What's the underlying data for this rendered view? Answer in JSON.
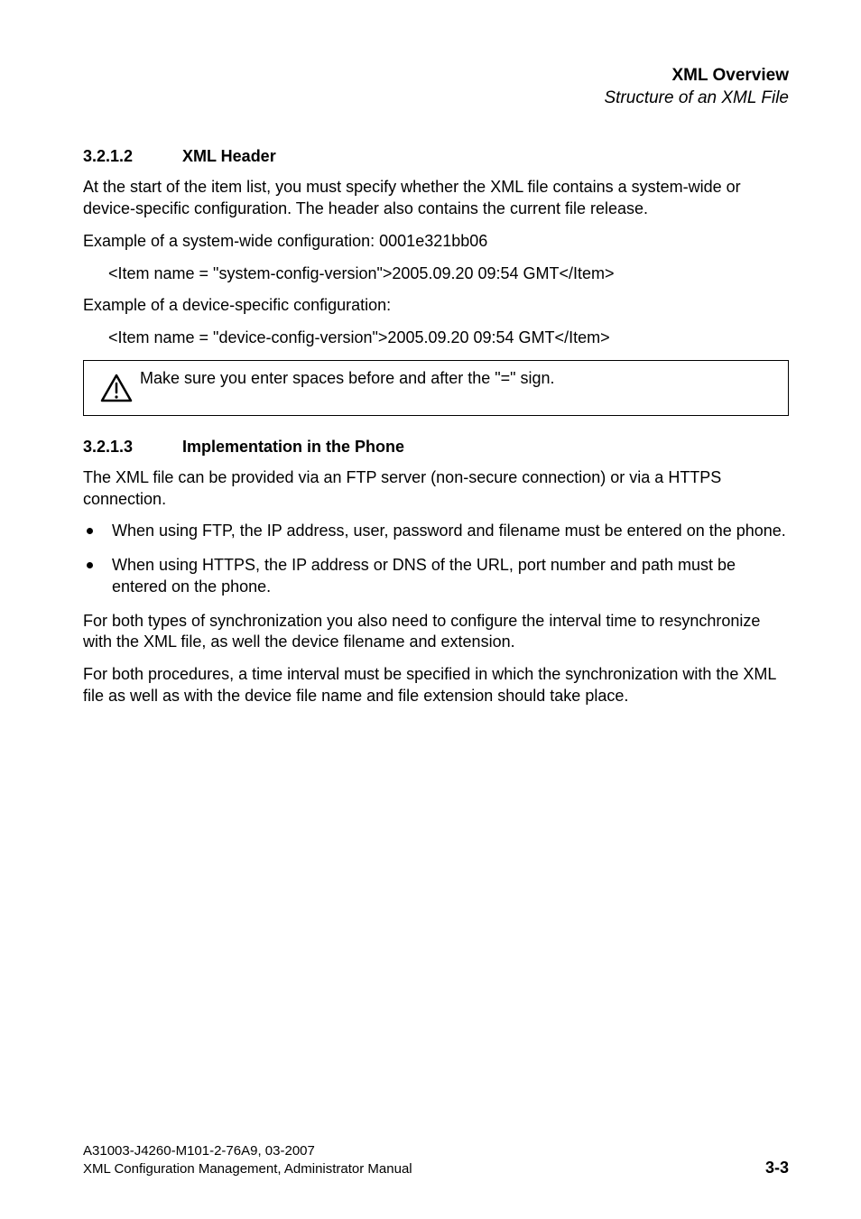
{
  "header": {
    "title": "XML Overview",
    "subtitle": "Structure of an XML File"
  },
  "section1": {
    "number": "3.2.1.2",
    "title": "XML Header",
    "p1": "At the start of the item list, you must specify whether the XML file contains a system-wide or device-specific configuration. The header also contains the current file release.",
    "p2": "Example of a system-wide configuration: 0001e321bb06",
    "code1": "<Item name = \"system-config-version\">2005.09.20 09:54 GMT</Item>",
    "p3": "Example of a device-specific configuration:",
    "code2": "<Item name = \"device-config-version\">2005.09.20 09:54 GMT</Item>",
    "note": "Make sure you enter spaces before and after the \"=\" sign."
  },
  "section2": {
    "number": "3.2.1.3",
    "title": "Implementation in the Phone",
    "p1": "The XML file can be provided via an FTP server (non-secure connection) or via a HTTPS connection.",
    "bullets": [
      "When using FTP, the IP address, user, password and filename must be entered on the phone.",
      "When using HTTPS, the IP address or DNS of the URL, port number and path must be entered on the phone."
    ],
    "p2": "For both types of synchronization you also need to configure the interval time to resynchronize with the XML file, as well the device filename and extension.",
    "p3": "For both procedures, a time interval must be specified in which the synchronization with the XML file as well as with the device file name and file extension should take place."
  },
  "footer": {
    "line1": "A31003-J4260-M101-2-76A9, 03-2007",
    "line2": "XML Configuration Management, Administrator Manual",
    "page": "3-3"
  }
}
